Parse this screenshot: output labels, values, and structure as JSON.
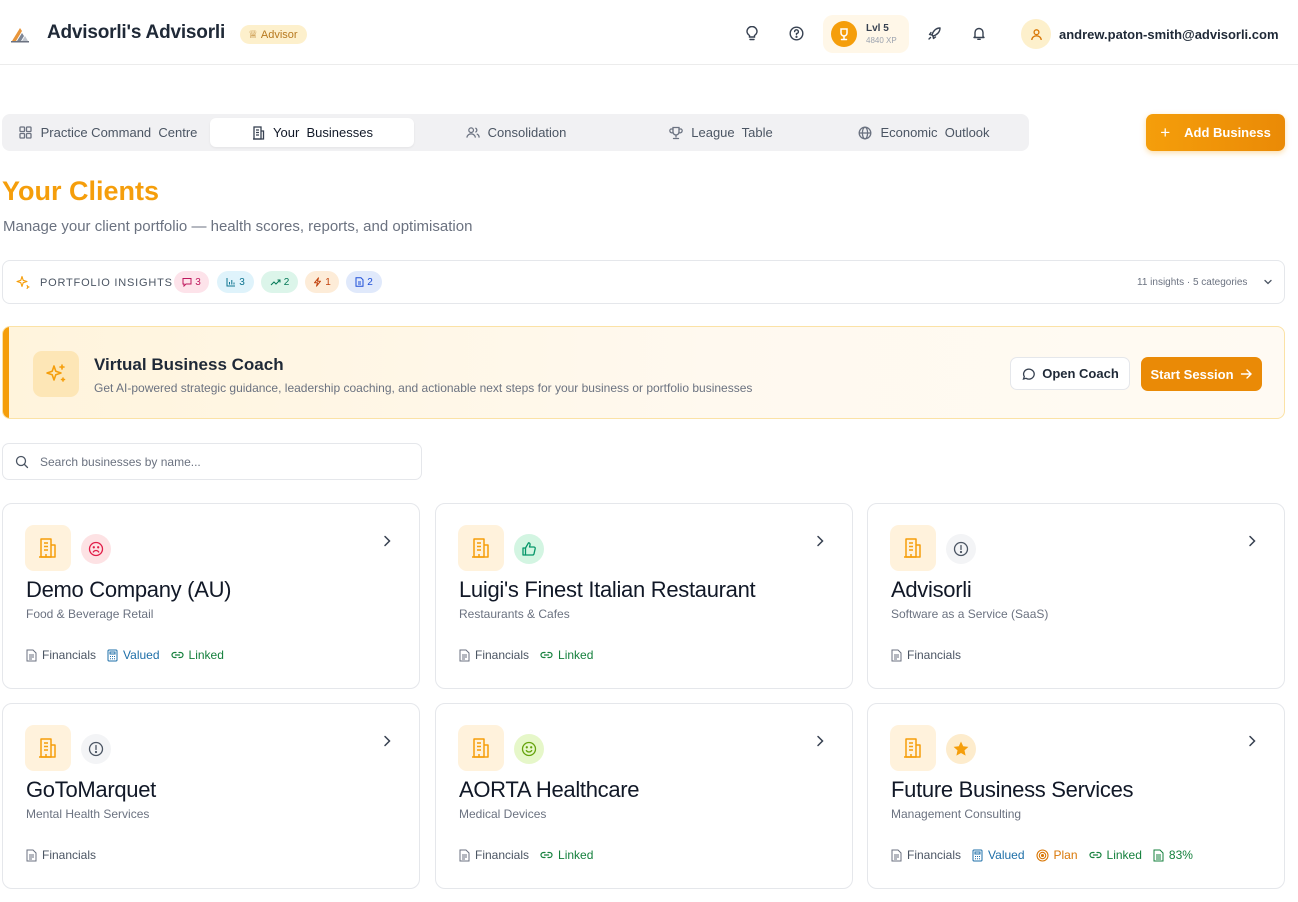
{
  "header": {
    "app_title": "Advisorli's Advisorli",
    "role_badge": "Advisor",
    "level": "Lvl 5",
    "xp": "4840 XP",
    "user_email": "andrew.paton-smith@advisorli.com",
    "icons": [
      "lightbulb-icon",
      "help-circle-icon",
      "trophy-icon",
      "rocket-icon",
      "bell-icon",
      "user-icon"
    ]
  },
  "tabs": [
    {
      "label": "Practice Command  Centre",
      "icon": "grid-icon",
      "active": false
    },
    {
      "label": "Your  Businesses",
      "icon": "building-icon",
      "active": true
    },
    {
      "label": "Consolidation",
      "icon": "users-icon",
      "active": false
    },
    {
      "label": "League  Table",
      "icon": "trophy-icon",
      "active": false
    },
    {
      "label": "Economic  Outlook",
      "icon": "globe-icon",
      "active": false
    }
  ],
  "add_business_label": "Add Business",
  "page": {
    "title": "Your Clients",
    "subtitle": "Manage your client portfolio — health scores, reports, and optimisation"
  },
  "insights": {
    "label": "PORTFOLIO INSIGHTS",
    "chips": [
      {
        "icon": "message-icon",
        "count": "3",
        "bg": "#fde3ea",
        "color": "#be185d"
      },
      {
        "icon": "bar-chart-icon",
        "count": "3",
        "bg": "#dff3fb",
        "color": "#0e7490"
      },
      {
        "icon": "trending-up-icon",
        "count": "2",
        "bg": "#dcf5ea",
        "color": "#047857"
      },
      {
        "icon": "zap-icon",
        "count": "1",
        "bg": "#fdecd8",
        "color": "#c2410c"
      },
      {
        "icon": "document-icon",
        "count": "2",
        "bg": "#e0e9fb",
        "color": "#1d4ed8"
      }
    ],
    "summary": "11 insights · 5 categories"
  },
  "coach": {
    "title": "Virtual Business Coach",
    "description": "Get AI-powered strategic guidance, leadership coaching, and actionable next steps for your business or portfolio businesses",
    "open_label": "Open Coach",
    "start_label": "Start Session"
  },
  "search": {
    "placeholder": "Search businesses by name..."
  },
  "businesses": [
    {
      "name": "Demo Company (AU)",
      "industry": "Food & Beverage Retail",
      "health": "frown-icon",
      "tags": [
        "Financials",
        "Valued",
        "Linked"
      ]
    },
    {
      "name": "Luigi's Finest Italian Restaurant",
      "industry": "Restaurants & Cafes",
      "health": "thumbs-up-icon",
      "tags": [
        "Financials",
        "Linked"
      ]
    },
    {
      "name": "Advisorli",
      "industry": "Software as a Service (SaaS)",
      "health": "alert-circle-icon",
      "tags": [
        "Financials"
      ]
    },
    {
      "name": "GoToMarquet",
      "industry": "Mental Health Services",
      "health": "alert-circle-icon",
      "tags": [
        "Financials"
      ]
    },
    {
      "name": "AORTA Healthcare",
      "industry": "Medical Devices",
      "health": "smile-icon",
      "tags": [
        "Financials",
        "Linked"
      ]
    },
    {
      "name": "Future Business Services",
      "industry": "Management Consulting",
      "health": "star-icon",
      "tags": [
        "Financials",
        "Valued",
        "Plan",
        "Linked",
        "83%"
      ]
    }
  ],
  "colors": {
    "accent": "#f59e0b",
    "valued": "#1e6fa8",
    "linked": "#15803d",
    "plan": "#d97706"
  }
}
